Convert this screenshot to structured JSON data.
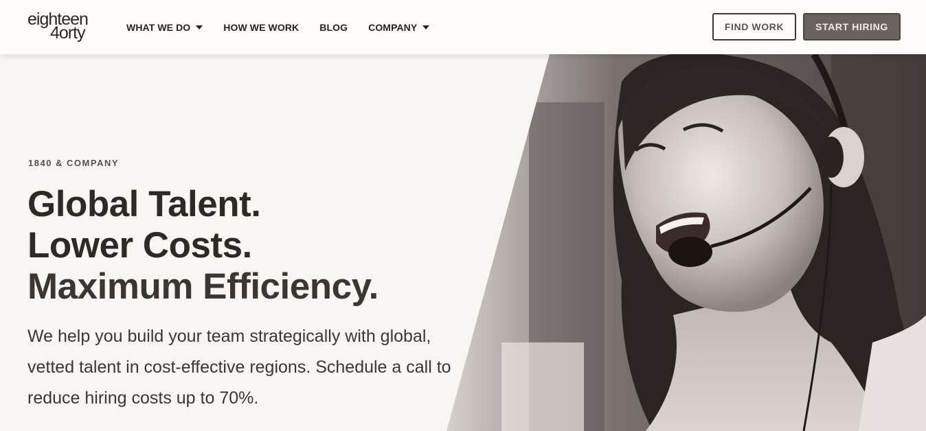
{
  "header": {
    "logo_line1": "eighteen",
    "logo_line2": "4orty",
    "nav": [
      {
        "label": "WHAT WE DO",
        "has_dropdown": true
      },
      {
        "label": "HOW WE WORK",
        "has_dropdown": false
      },
      {
        "label": "BLOG",
        "has_dropdown": false
      },
      {
        "label": "COMPANY",
        "has_dropdown": true
      }
    ],
    "find_work_label": "FIND WORK",
    "start_hiring_label": "START HIRING"
  },
  "hero": {
    "eyebrow": "1840 & COMPANY",
    "headline": [
      "Global Talent.",
      "Lower Costs.",
      "Maximum Efficiency."
    ],
    "subtext": "We help you build your team strategically with global, vetted talent in cost-effective regions. Schedule a call to reduce hiring costs up to 70%.",
    "image_subject": "smiling woman wearing a call-center headset"
  },
  "colors": {
    "background": "#f8f6f4",
    "header_bg": "#fdfcfa",
    "text_dark": "#2d2925",
    "button_fill": "#6a6461"
  }
}
